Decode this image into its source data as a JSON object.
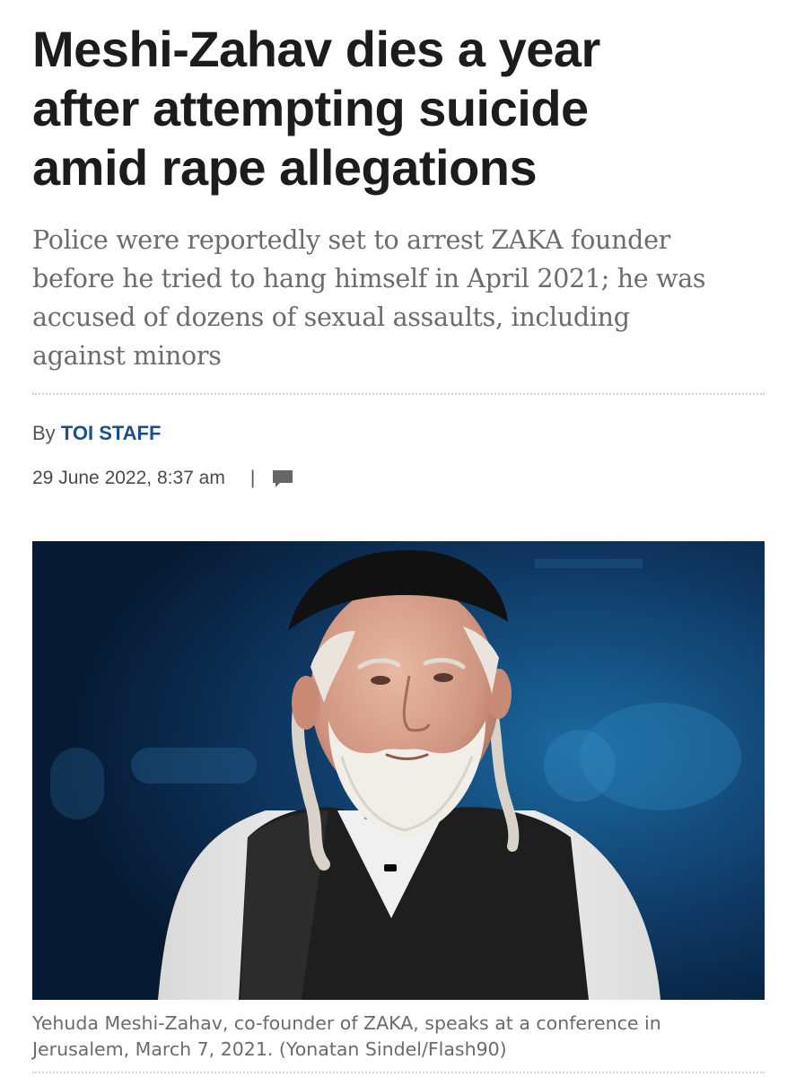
{
  "article": {
    "headline_lines": [
      "Meshi-Zahav dies a year",
      "after attempting suicide",
      "amid rape allegations"
    ],
    "subheadline_lines": [
      "Police were reportedly set to arrest ZAKA founder",
      "before he tried to hang himself in April 2021; he was",
      "accused of dozens of sexual assaults, including",
      "against minors"
    ],
    "byline_prefix": "By",
    "author": "TOI STAFF",
    "timestamp": "29 June 2022, 8:37 am",
    "meta_separator": "|",
    "comment_icon": "comment-icon",
    "photo": {
      "description_icon": "photo-of-speaker"
    },
    "caption_lines": [
      "Yehuda Meshi-Zahav, co-founder of ZAKA, speaks at a conference in",
      "Jerusalem, March 7, 2021. (Yonatan Sindel/Flash90)"
    ]
  },
  "colors": {
    "headline": "#1c1c1c",
    "subheadline": "#6c6c6c",
    "author_link": "#1f4e8c",
    "photo_background": "#0d2b4a"
  }
}
